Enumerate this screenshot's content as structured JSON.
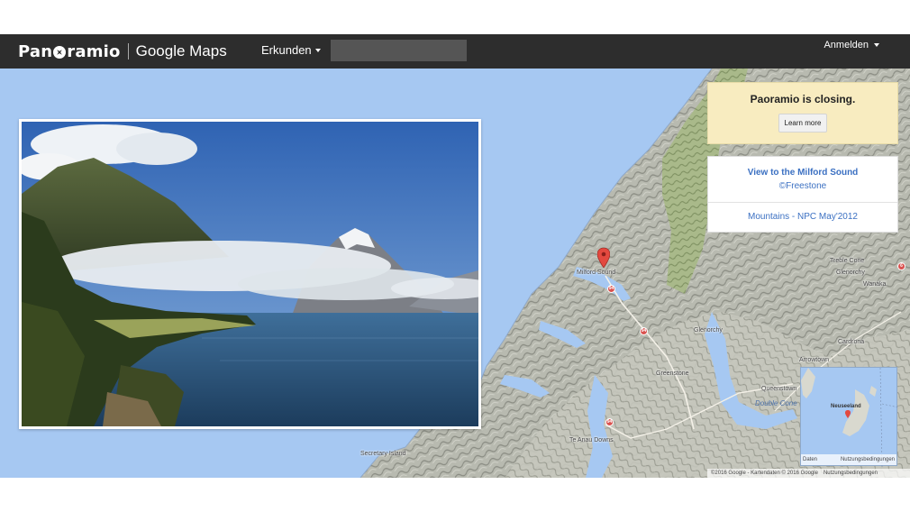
{
  "header": {
    "brand": "Panoramio",
    "brand_sub": "Google Maps",
    "nav_explore": "Erkunden",
    "search_placeholder": "",
    "login": "Anmelden"
  },
  "notice": {
    "text": "Paoramio is closing.",
    "button": "Learn more"
  },
  "photo_info": {
    "title": "View to the Milford Sound",
    "author": "©Freestone",
    "group": "Mountains - NPC May'2012"
  },
  "map": {
    "places": [
      {
        "name": "Milford Sound"
      },
      {
        "name": "Glenorchy"
      },
      {
        "name": "Greenstone"
      },
      {
        "name": "Queenstown"
      },
      {
        "name": "Arrowtown"
      },
      {
        "name": "Cardrona"
      },
      {
        "name": "Glenorchy"
      },
      {
        "name": "Wanaka"
      },
      {
        "name": "Treble Cone"
      },
      {
        "name": "Te Anau Downs"
      },
      {
        "name": "Secretary Island"
      }
    ],
    "water_labels": [
      "Double Cone"
    ],
    "road_numbers": [
      "94",
      "94",
      "94",
      "6"
    ],
    "inset_label": "Neuseeland",
    "inset_left_term": "Daten",
    "inset_right_term": "Nutzungsbedingungen",
    "attribution": "©2016 Google - Kartendaten © 2016 Google",
    "terms": "Nutzungsbedingungen"
  }
}
